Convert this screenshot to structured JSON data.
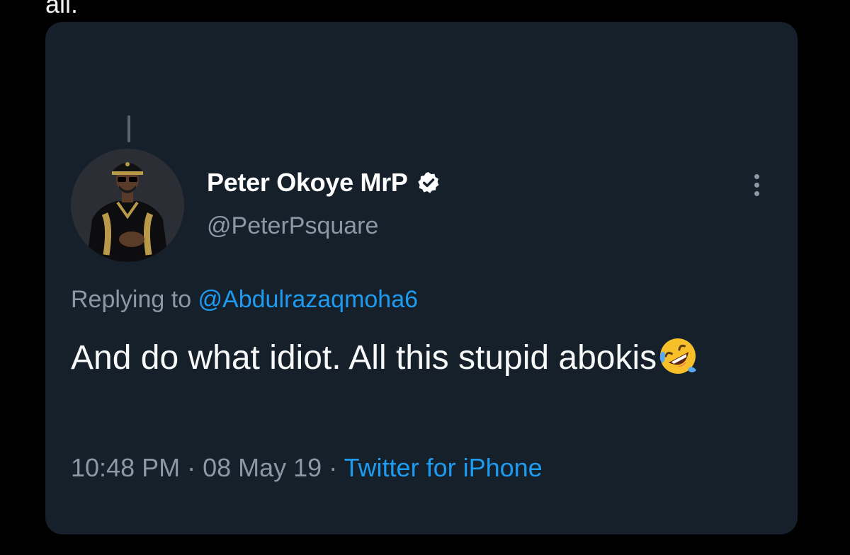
{
  "above_text": "all.",
  "tweet": {
    "display_name": "Peter Okoye MrP",
    "handle": "@PeterPsquare",
    "verified": true,
    "replying_prefix": "Replying to ",
    "replying_to": "@Abdulrazaqmoha6",
    "text": "And do what idiot. All this stupid abokis",
    "emoji": "rolling-on-floor-laughing",
    "time": "10:48 PM",
    "separator_1": " · ",
    "date": "08 May 19",
    "separator_2": " · ",
    "source": "Twitter for iPhone"
  },
  "colors": {
    "page_bg": "#000000",
    "card_bg": "#15202b",
    "primary_text": "#f7f9f9",
    "secondary_text": "#8b98a5",
    "accent": "#1d9bf0"
  }
}
